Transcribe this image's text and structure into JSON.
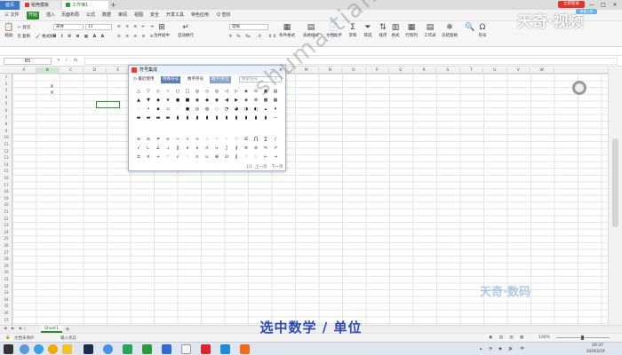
{
  "titlebar": {
    "home_tab": "首页",
    "tab1": "稻壳模板",
    "tab2": "工作簿1",
    "add_tab": "+",
    "login_button": "立即登录",
    "minimize": "—",
    "maximize": "□",
    "close": "×"
  },
  "menubar": {
    "items": [
      "三 文件",
      "开始",
      "插入",
      "页面布局",
      "公式",
      "数据",
      "审阅",
      "视图",
      "安全",
      "开发工具",
      "特色应用",
      "Q 查找"
    ],
    "active": "开始"
  },
  "ribbon": {
    "paste": "粘贴",
    "cut": "剪切",
    "copy": "复制",
    "format_painter": "格式刷",
    "font_name": "宋体",
    "font_size": "11",
    "merge_center": "合并居中",
    "wrap_text": "自动换行",
    "number_format": "常规",
    "cond_format": "条件格式",
    "cell_style": "表格样式",
    "doc_helper": "文档助手",
    "sum": "求和",
    "filter": "筛选",
    "sort": "排序",
    "format": "格式",
    "row_col": "行和列",
    "worksheet": "工作表",
    "freeze": "冻结窗格",
    "symbol": "符号"
  },
  "formula_bar": {
    "name_box": "B5",
    "fx": "fx"
  },
  "grid": {
    "columns": [
      "A",
      "B",
      "C",
      "D",
      "E",
      "F",
      "G",
      "H",
      "I",
      "J",
      "K",
      "L",
      "M",
      "N",
      "O",
      "P",
      "Q",
      "R",
      "S",
      "T",
      "U",
      "V",
      "W"
    ],
    "selected_column": "B",
    "rows": [
      "1",
      "2",
      "3",
      "4",
      "5",
      "6",
      "7",
      "8",
      "9",
      "10",
      "11",
      "12",
      "13",
      "14",
      "15",
      "16",
      "17",
      "18",
      "19",
      "20",
      "21",
      "22",
      "23",
      "24",
      "25",
      "26",
      "27",
      "28",
      "29",
      "30",
      "31",
      "32",
      "33",
      "34",
      "35",
      "36",
      "37"
    ],
    "cell_a2": "×",
    "cell_a3": "×"
  },
  "dialog": {
    "title": "符号集成",
    "minimize": "—",
    "close": "×",
    "tabs": [
      "最近使用",
      "特殊符号",
      "数字序号",
      "数学/单位"
    ],
    "search_placeholder": "搜索符号",
    "symbols": [
      [
        "△",
        "▽",
        "◇",
        "☆",
        "○",
        "□",
        "◎",
        "◇",
        "◎",
        "◁",
        "▷",
        "◈",
        "⊙",
        "▣",
        "▤"
      ],
      [
        "▲",
        "▼",
        "◆",
        "★",
        "●",
        "■",
        "◉",
        "◆",
        "◉",
        "◀",
        "▶",
        "◈",
        "⊛",
        "▩",
        "▦"
      ],
      [
        "·",
        "•",
        "▪",
        "▫",
        "◦",
        "●",
        "◎",
        "◍",
        "◌",
        "◔",
        "◕",
        "◑",
        "◐",
        "▴",
        "▾"
      ],
      [
        "▬",
        "▬",
        "▬",
        "▬",
        "▮",
        "▮",
        "▮",
        "▮",
        "▮",
        "▮",
        "▮",
        "▮",
        "▮",
        "▮",
        "—"
      ],
      [
        "",
        "",
        "",
        "",
        "",
        "",
        "",
        "",
        "",
        "",
        "",
        "",
        "",
        "",
        ""
      ],
      [
        "≥",
        "≤",
        "≠",
        "≈",
        "∽",
        "∝",
        "∞",
        "∴",
        "∵",
        "∶",
        "∷",
        "∈",
        "∏",
        "∑",
        "∕"
      ],
      [
        "√",
        "∟",
        "∠",
        "⊥",
        "∥",
        "∧",
        "∨",
        "∩",
        "∪",
        "∫",
        "∮",
        "≡",
        "≌",
        "≒",
        "↗"
      ],
      [
        "±",
        "×",
        "÷",
        "∵",
        "√",
        "∶",
        "∩",
        "∪",
        "⊕",
        "⊙",
        "∥",
        "∶",
        "∴",
        "←",
        "→"
      ]
    ],
    "page_indicator": "1/1",
    "prev_page": "上一页",
    "next_page": "下一页"
  },
  "sheetbar": {
    "sheet_name": "Sheet1",
    "add_sheet": "+"
  },
  "statusbar": {
    "doc_protect": "文档未保护",
    "input_status": "输入状态",
    "zoom": "100%"
  },
  "taskbar": {
    "time": "20:37",
    "date": "2020/2/19"
  },
  "overlay": {
    "watermark": "shuma.tianqijun.com",
    "caption": "选中数学 / 单位",
    "logo_top": "天奇·视频",
    "logo_top_badge": "新建立场",
    "logo_bottom": "天奇·数码"
  }
}
